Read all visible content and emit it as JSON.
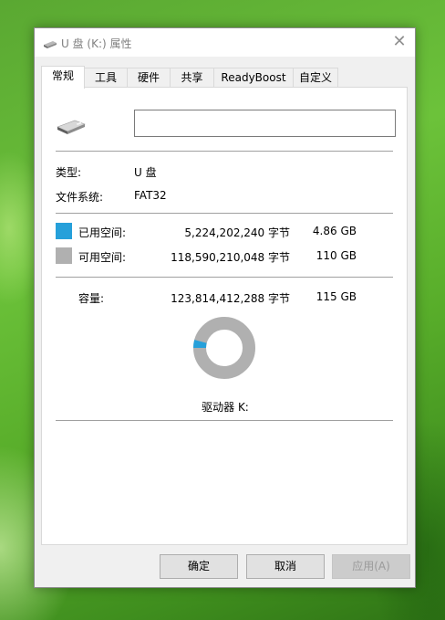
{
  "window": {
    "title": "U 盘 (K:) 属性",
    "close_glyph": "✕"
  },
  "tabs": [
    {
      "label": "常规",
      "active": true
    },
    {
      "label": "工具",
      "active": false
    },
    {
      "label": "硬件",
      "active": false
    },
    {
      "label": "共享",
      "active": false
    },
    {
      "label": "ReadyBoost",
      "active": false
    },
    {
      "label": "自定义",
      "active": false
    }
  ],
  "general": {
    "drive_icon": "usb-drive-icon",
    "name_value": "",
    "type_label": "类型:",
    "type_value": "U 盘",
    "fs_label": "文件系统:",
    "fs_value": "FAT32",
    "used": {
      "label": "已用空间:",
      "bytes": "5,224,202,240 字节",
      "size": "4.86 GB",
      "color": "#26a0da"
    },
    "free": {
      "label": "可用空间:",
      "bytes": "118,590,210,048 字节",
      "size": "110 GB",
      "color": "#b0b0b0"
    },
    "capacity": {
      "label": "容量:",
      "bytes": "123,814,412,288 字节",
      "size": "115 GB"
    },
    "used_fraction": 0.0422,
    "drive_label": "驱动器 K:"
  },
  "buttons": {
    "ok": "确定",
    "cancel": "取消",
    "apply": "应用(A)"
  }
}
